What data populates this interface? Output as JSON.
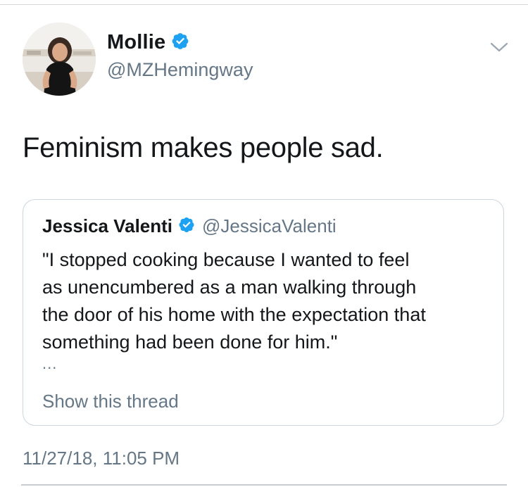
{
  "tweet": {
    "author": {
      "display_name": "Mollie",
      "handle": "@MZHemingway",
      "verified": true,
      "avatar_icon": "profile-photo"
    },
    "text": "Feminism makes people sad.",
    "timestamp": "11/27/18, 11:05 PM",
    "menu_icon": "chevron-down-icon"
  },
  "quoted_tweet": {
    "author": {
      "display_name": "Jessica Valenti",
      "handle": "@JessicaValenti",
      "verified": true
    },
    "text": "\"I stopped cooking because I wanted to feel\nas unencumbered as a man walking through\nthe door of his home with the expectation that\nsomething had been done for him.\"",
    "ellipsis": "...",
    "show_thread_label": "Show this thread"
  },
  "colors": {
    "verified_blue": "#1da1f2",
    "secondary_text": "#657786",
    "primary_text": "#14171a",
    "card_border": "#ccd6dd"
  }
}
